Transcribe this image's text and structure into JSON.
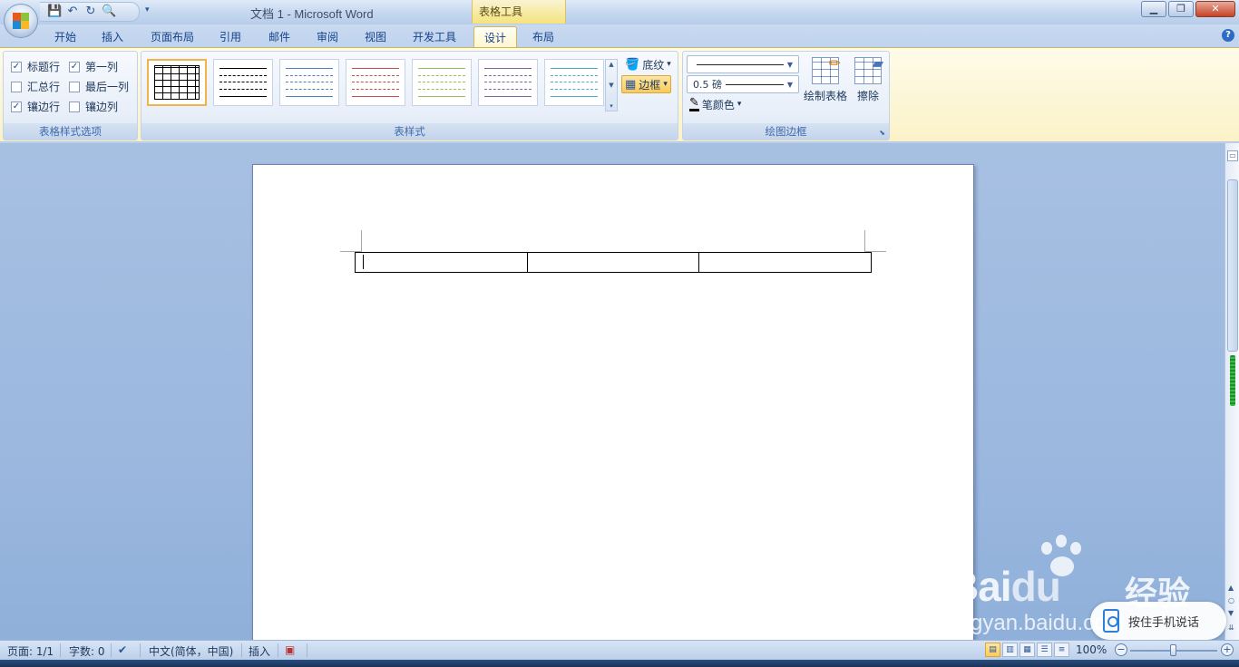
{
  "window": {
    "title": "文档 1 - Microsoft Word",
    "context_tab_header": "表格工具",
    "controls": {
      "minimize": "▁",
      "maximize": "❐",
      "close": "✕"
    }
  },
  "quick_access": {
    "icons": [
      "save-icon",
      "undo-icon",
      "redo-icon",
      "print-preview-icon"
    ],
    "glyphs": [
      "💾",
      "↶",
      "↻",
      "🔍"
    ],
    "more": "▾"
  },
  "tabs": [
    {
      "label": "开始"
    },
    {
      "label": "插入"
    },
    {
      "label": "页面布局"
    },
    {
      "label": "引用"
    },
    {
      "label": "邮件"
    },
    {
      "label": "审阅"
    },
    {
      "label": "视图"
    },
    {
      "label": "开发工具"
    },
    {
      "label": "设计",
      "active": true
    },
    {
      "label": "布局"
    }
  ],
  "help_glyph": "?",
  "ribbon": {
    "style_options": {
      "label": "表格样式选项",
      "options": [
        {
          "label": "标题行",
          "checked": true
        },
        {
          "label": "第一列",
          "checked": true
        },
        {
          "label": "汇总行",
          "checked": false
        },
        {
          "label": "最后一列",
          "checked": false
        },
        {
          "label": "镶边行",
          "checked": true
        },
        {
          "label": "镶边列",
          "checked": false
        }
      ],
      "check_glyph": "✓"
    },
    "table_styles": {
      "label": "表样式",
      "thumb_colors": [
        "#000000",
        "#000000",
        "#4f81bd",
        "#c0504d",
        "#9bbb59",
        "#8064a2",
        "#4bacc6"
      ],
      "shading_label": "底纹",
      "borders_label": "边框",
      "dropdown_glyph": "▾"
    },
    "draw_borders": {
      "label": "绘图边框",
      "line_weight": "0.5 磅",
      "pen_color_label": "笔颜色",
      "draw_table_label": "绘制表格",
      "eraser_label": "擦除",
      "launcher_glyph": "⬊"
    }
  },
  "statusbar": {
    "page": "页面: 1/1",
    "words": "字数: 0",
    "language": "中文(简体，中国)",
    "mode": "插入",
    "zoom": "100%",
    "zoom_minus": "−",
    "zoom_plus": "+"
  },
  "watermark": {
    "logo": "Bai",
    "logo2": "du",
    "cn": "经验",
    "url": "jingyan.baidu.com",
    "voice_label": "按住手机说话"
  }
}
